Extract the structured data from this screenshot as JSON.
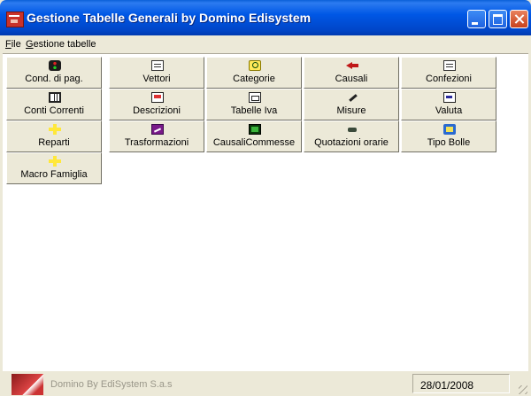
{
  "window": {
    "title": "Gestione Tabelle Generali by Domino Edisystem"
  },
  "menu": {
    "file": "File",
    "gestione": "Gestione tabelle"
  },
  "tiles": [
    {
      "label": "Cond. di pag.",
      "icon": "traffic-light-icon"
    },
    {
      "label": "Vettori",
      "icon": "document-icon"
    },
    {
      "label": "Categorie",
      "icon": "search-folder-icon"
    },
    {
      "label": "Causali",
      "icon": "left-arrow-icon"
    },
    {
      "label": "Confezioni",
      "icon": "list-document-icon"
    },
    {
      "label": "Conti Correnti",
      "icon": "ledger-icon"
    },
    {
      "label": "Descrizioni",
      "icon": "note-icon"
    },
    {
      "label": "Tabelle Iva",
      "icon": "table-icon"
    },
    {
      "label": "Misure",
      "icon": "pen-icon"
    },
    {
      "label": "Valuta",
      "icon": "currency-icon"
    },
    {
      "label": "Reparti",
      "icon": "cross-icon"
    },
    {
      "label": "Trasformazioni",
      "icon": "chart-icon"
    },
    {
      "label": "CausaliCommesse",
      "icon": "film-icon"
    },
    {
      "label": "Quotazioni orarie",
      "icon": "clock-icon"
    },
    {
      "label": "Tipo Bolle",
      "icon": "bolle-icon"
    },
    {
      "label": "Macro Famiglia",
      "icon": "cross-icon"
    }
  ],
  "status": {
    "company": "Domino By EdiSystem S.a.s",
    "date": "28/01/2008"
  }
}
